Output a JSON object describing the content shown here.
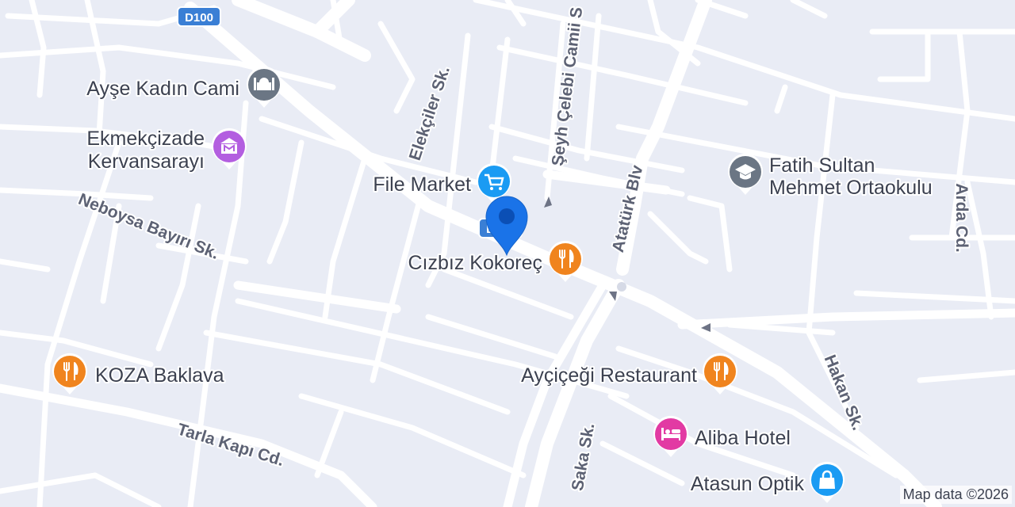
{
  "map": {
    "attribution": "Map data ©2026",
    "route_shields": [
      "D100",
      "D100"
    ],
    "pois": [
      {
        "name": "Ayşe Kadın Cami",
        "category": "mosque",
        "icon": "mosque-icon",
        "color": "#6b7684"
      },
      {
        "name": "Ekmekçizade",
        "name_line2": "Kervansarayı",
        "category": "museum",
        "icon": "museum-icon",
        "color": "#b35ee0"
      },
      {
        "name": "File Market",
        "category": "shopping",
        "icon": "cart-icon",
        "color": "#1a9bf3"
      },
      {
        "name": "Fatih Sultan",
        "name_line2": "Mehmet Ortaokulu",
        "category": "school",
        "icon": "graduation-cap-icon",
        "color": "#6b7684"
      },
      {
        "name": "Cızbız Kokoreç",
        "category": "restaurant",
        "icon": "fork-knife-icon",
        "color": "#f0841e"
      },
      {
        "name": "KOZA Baklava",
        "category": "restaurant",
        "icon": "fork-knife-icon",
        "color": "#f0841e"
      },
      {
        "name": "Ayçiçeği Restaurant",
        "category": "restaurant",
        "icon": "fork-knife-icon",
        "color": "#f0841e"
      },
      {
        "name": "Aliba Hotel",
        "category": "hotel",
        "icon": "bed-icon",
        "color": "#e23aa3"
      },
      {
        "name": "Atasun Optik",
        "category": "shopping",
        "icon": "shopping-bag-icon",
        "color": "#1a9bf3"
      }
    ],
    "streets": [
      "Elekçiler Sk.",
      "Şeyh Çelebi Camii S",
      "Atatürk Blv",
      "Arda Cd.",
      "Neboysa Bayırı Sk.",
      "Hakan Sk.",
      "Tarla Kapı Cd.",
      "Saka Sk."
    ],
    "selected_pin": {
      "icon": "location-pin-icon",
      "color": "#1a73e8"
    }
  }
}
